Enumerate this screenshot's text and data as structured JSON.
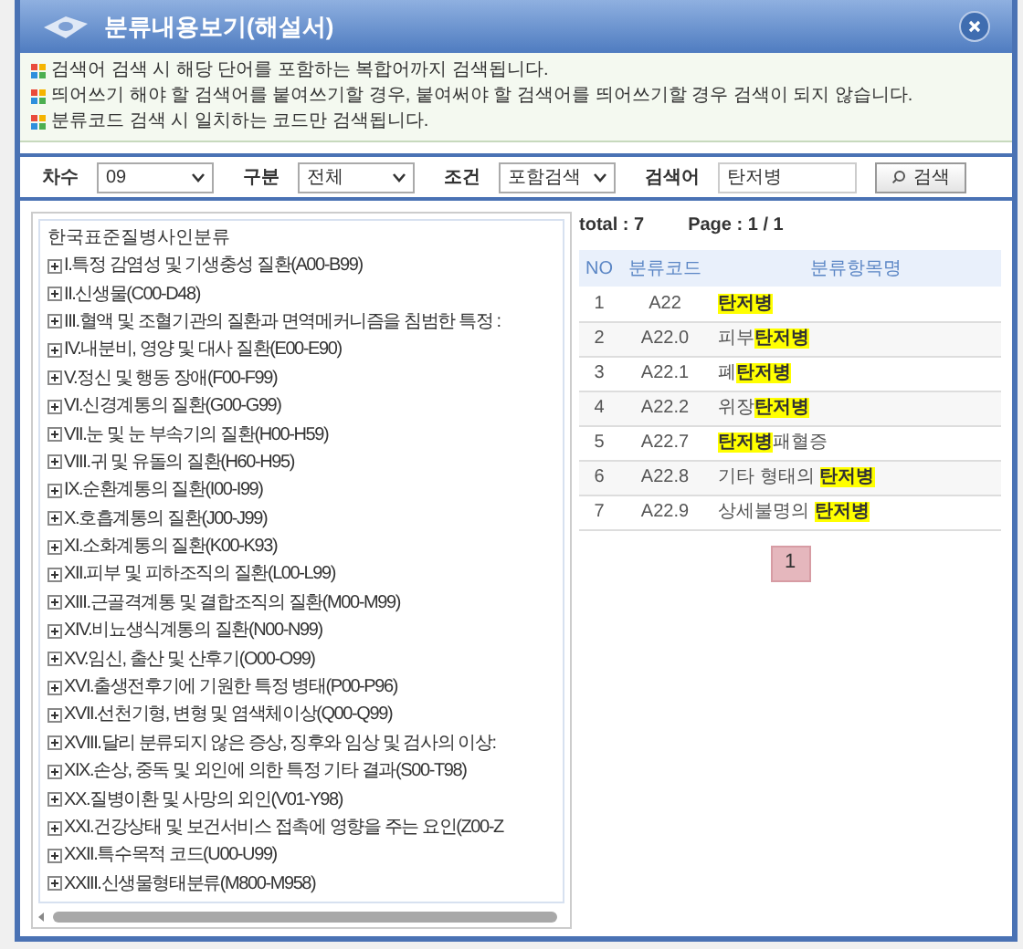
{
  "window": {
    "title": "분류내용보기(해설서)"
  },
  "notices": [
    "검색어 검색 시 해당 단어를 포함하는 복합어까지 검색됩니다.",
    "띄어쓰기 해야 할 검색어를 붙여쓰기할 경우, 붙여써야 할 검색어를 띄어쓰기할 경우 검색이 되지 않습니다.",
    "분류코드 검색 시 일치하는 코드만 검색됩니다."
  ],
  "search": {
    "fields": [
      {
        "label": "차수",
        "value": "09"
      },
      {
        "label": "구분",
        "value": "전체"
      },
      {
        "label": "조건",
        "value": "포함검색"
      }
    ],
    "keyword_label": "검색어",
    "keyword": "탄저병",
    "button": "검색"
  },
  "tree": {
    "root": "한국표준질병사인분류",
    "items": [
      {
        "label": "I.특정 감염성 및 기생충성 질환(A00-B99)",
        "expanded": false
      },
      {
        "label": "II.신생물(C00-D48)",
        "expanded": false
      },
      {
        "label": "III.혈액 및 조혈기관의 질환과 면역메커니즘을 침범한 특정 :",
        "expanded": false
      },
      {
        "label": "IV.내분비, 영양 및 대사 질환(E00-E90)",
        "expanded": false
      },
      {
        "label": "V.정신 및 행동 장애(F00-F99)",
        "expanded": false
      },
      {
        "label": "VI.신경계통의 질환(G00-G99)",
        "expanded": false
      },
      {
        "label": "VII.눈 및 눈 부속기의 질환(H00-H59)",
        "expanded": false
      },
      {
        "label": "VIII.귀 및 유돌의 질환(H60-H95)",
        "expanded": false
      },
      {
        "label": "IX.순환계통의 질환(I00-I99)",
        "expanded": false
      },
      {
        "label": "X.호흡계통의 질환(J00-J99)",
        "expanded": false
      },
      {
        "label": "XI.소화계통의 질환(K00-K93)",
        "expanded": false
      },
      {
        "label": "XII.피부 및 피하조직의 질환(L00-L99)",
        "expanded": false
      },
      {
        "label": "XIII.근골격계통 및 결합조직의 질환(M00-M99)",
        "expanded": false
      },
      {
        "label": "XIV.비뇨생식계통의 질환(N00-N99)",
        "expanded": false
      },
      {
        "label": "XV.임신, 출산 및 산후기(O00-O99)",
        "expanded": false
      },
      {
        "label": "XVI.출생전후기에 기원한 특정 병태(P00-P96)",
        "expanded": false
      },
      {
        "label": "XVII.선천기형, 변형 및 염색체이상(Q00-Q99)",
        "expanded": false
      },
      {
        "label": "XVIII.달리 분류되지 않은 증상, 징후와 임상 및 검사의 이상:",
        "expanded": false
      },
      {
        "label": "XIX.손상, 중독 및 외인에 의한 특정 기타 결과(S00-T98)",
        "expanded": false
      },
      {
        "label": "XX.질병이환 및 사망의 외인(V01-Y98)",
        "expanded": false
      },
      {
        "label": "XXI.건강상태 및 보건서비스 접촉에 영향을 주는 요인(Z00-Z",
        "expanded": false
      },
      {
        "label": "XXII.특수목적 코드(U00-U99)",
        "expanded": false
      },
      {
        "label": "XXIII.신생물형태분류(M800-M958)",
        "expanded": false
      }
    ]
  },
  "results": {
    "total": "total : 7",
    "page": "Page : 1 / 1",
    "columns": [
      "NO",
      "분류코드",
      "분류항목명"
    ],
    "rows": [
      {
        "no": "1",
        "code": "A22",
        "name": [
          {
            "text": "탄저병",
            "highlight": true
          }
        ]
      },
      {
        "no": "2",
        "code": "A22.0",
        "name": [
          {
            "text": "피부",
            "highlight": false
          },
          {
            "text": "탄저병",
            "highlight": true
          }
        ]
      },
      {
        "no": "3",
        "code": "A22.1",
        "name": [
          {
            "text": "폐",
            "highlight": false
          },
          {
            "text": "탄저병",
            "highlight": true
          }
        ]
      },
      {
        "no": "4",
        "code": "A22.2",
        "name": [
          {
            "text": "위장",
            "highlight": false
          },
          {
            "text": "탄저병",
            "highlight": true
          }
        ]
      },
      {
        "no": "5",
        "code": "A22.7",
        "name": [
          {
            "text": "탄저병",
            "highlight": true
          },
          {
            "text": "패혈증",
            "highlight": false
          }
        ]
      },
      {
        "no": "6",
        "code": "A22.8",
        "name": [
          {
            "text": "기타 형태의 ",
            "highlight": false
          },
          {
            "text": "탄저병",
            "highlight": true
          }
        ]
      },
      {
        "no": "7",
        "code": "A22.9",
        "name": [
          {
            "text": "상세불명의 ",
            "highlight": false
          },
          {
            "text": "탄저병",
            "highlight": true
          }
        ]
      }
    ],
    "pages": [
      {
        "label": "1",
        "selected": true
      }
    ]
  }
}
